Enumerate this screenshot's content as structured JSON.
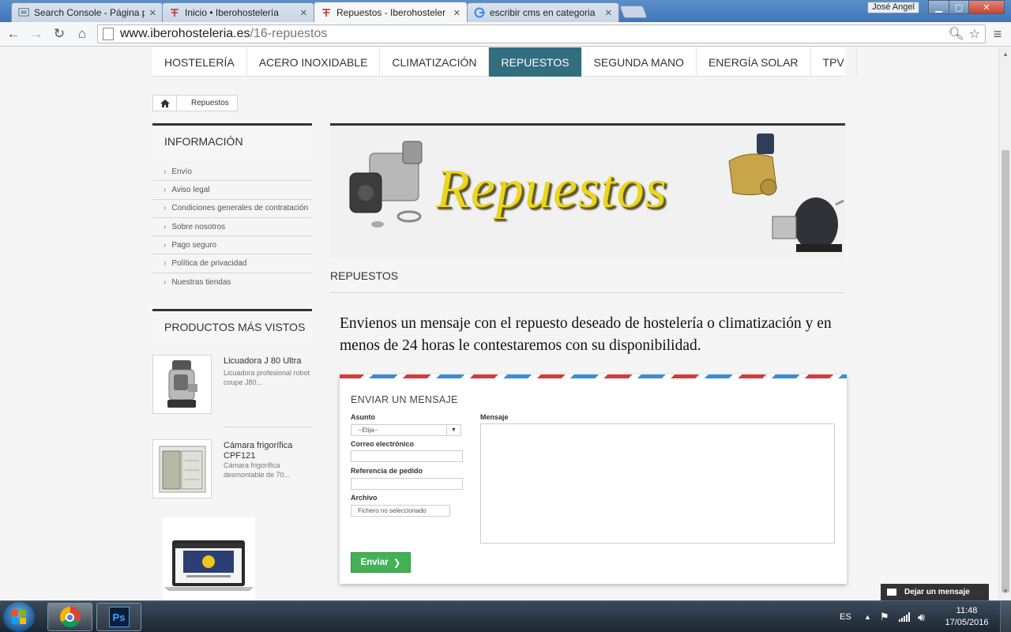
{
  "browser": {
    "tabs": [
      {
        "label": "Search Console - Página p",
        "icon": "search-console-icon"
      },
      {
        "label": "Inicio • Iberohostelería",
        "icon": "iberohosteleria-favicon"
      },
      {
        "label": "Repuestos - Iberohosteler",
        "icon": "iberohosteleria-favicon",
        "active": true
      },
      {
        "label": "escribir cms en categoria",
        "icon": "google-icon"
      }
    ],
    "user": "José Angel",
    "url_host": "www.iberohosteleria.es",
    "url_path": "/16-repuestos"
  },
  "topmenu": [
    "HOSTELERÍA",
    "ACERO INOXIDABLE",
    "CLIMATIZACIÓN",
    "REPUESTOS",
    "SEGUNDA MANO",
    "ENERGÍA SOLAR",
    "TPV"
  ],
  "topmenu_active_index": 3,
  "breadcrumb": {
    "current": "Repuestos"
  },
  "sidebar": {
    "info_title": "INFORMACIÓN",
    "info_items": [
      "Envío",
      "Aviso legal",
      "Condiciones generales de contratación",
      "Sobre nosotros",
      "Pago seguro",
      "Política de privacidad",
      "Nuestras tiendas"
    ],
    "viewed_title": "PRODUCTOS MÁS VISTOS",
    "products": [
      {
        "name": "Licuadora J 80 Ultra",
        "desc": "Licuadora profesional robot coupe J80..."
      },
      {
        "name": "Cámara frigorífica CPF121",
        "desc": "Cámara frigorífica desmontable de 70..."
      }
    ]
  },
  "banner": {
    "title": "Repuestos"
  },
  "page_heading": "REPUESTOS",
  "intro": "Envienos un mensaje con el repuesto deseado de hostelería o climatización y en menos de 24 horas le contestaremos con su disponibilidad.",
  "contact_form": {
    "title": "ENVIAR UN MENSAJE",
    "subject_label": "Asunto",
    "subject_value": "--Elija--",
    "email_label": "Correo electrónico",
    "order_label": "Referencia de pedido",
    "file_label": "Archivo",
    "file_value": "Fichero no seleccionado",
    "message_label": "Mensaje",
    "send_label": "Enviar"
  },
  "chat_widget": {
    "label": "Dejar un mensaje"
  },
  "taskbar": {
    "lang": "ES",
    "time": "11:48",
    "date": "17/05/2016"
  },
  "colors": {
    "accent": "#336d80",
    "send_button": "#43b155",
    "banner_text": "#ead61e"
  }
}
